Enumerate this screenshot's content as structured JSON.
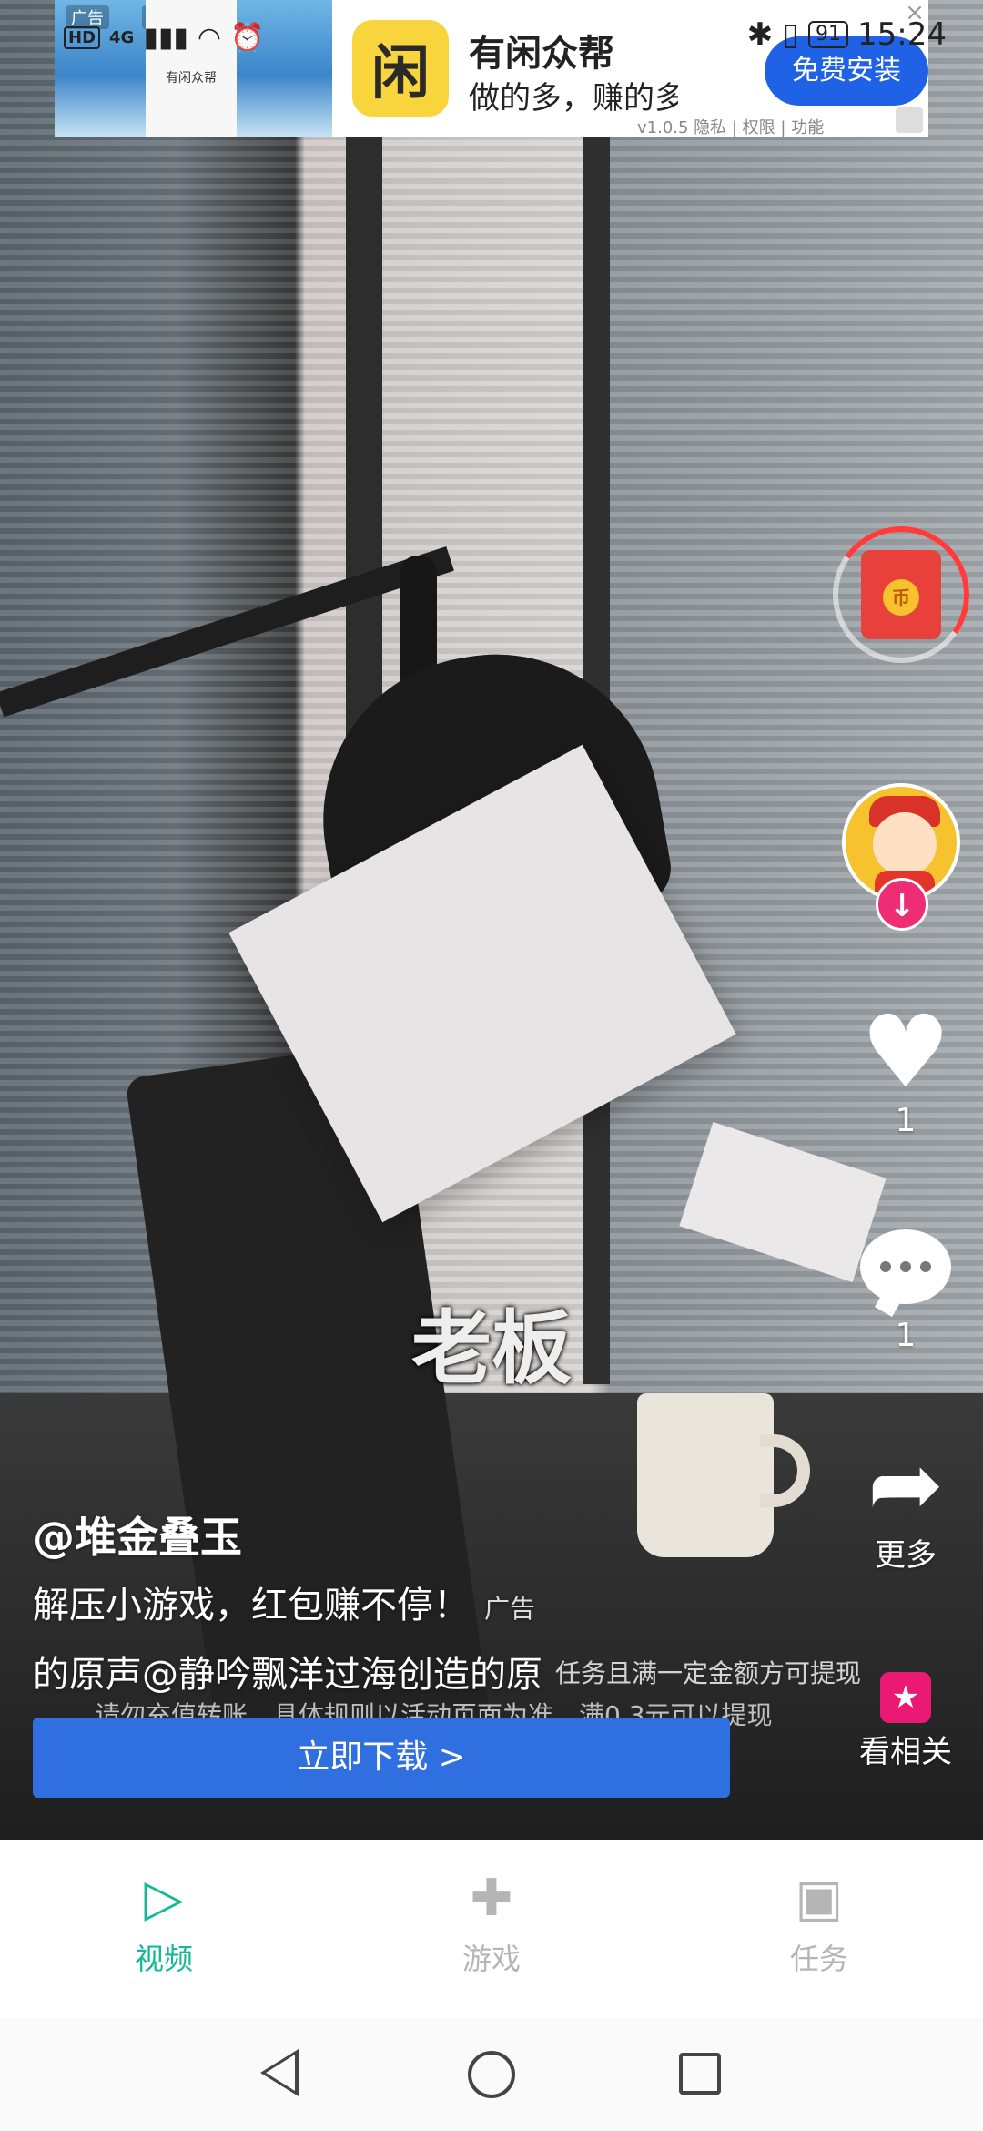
{
  "status_bar": {
    "network": "4G",
    "hd": "HD",
    "battery": "91",
    "time": "15:24"
  },
  "top_ad": {
    "tag_left": "广告",
    "tag_right": "广告",
    "thumb_app_name": "有闲众帮",
    "logo_char": "闲",
    "title": "有闲众帮",
    "subtitle": "做的多，赚的多!",
    "install_label": "免费安装",
    "meta": "v1.0.5 隐私 | 权限 | 功能",
    "close": "×"
  },
  "video": {
    "subtitle": "老板"
  },
  "sidebar": {
    "redpacket_icon": "coin-icon",
    "redpacket_coin": "币",
    "follow_symbol": "↓",
    "like_count": "1",
    "comment_count": "1",
    "share_label": "更多",
    "related_label": "看相关",
    "related_symbol": "★"
  },
  "post": {
    "username": "@堆金叠玉",
    "description": "解压小游戏，红包赚不停！",
    "ad_label": "广告",
    "music": "的原声@静吟飘洋过海创造的原",
    "music_overlay": "任务且满一定金额方可提现",
    "notice": "请勿充值转账，具体规则以活动页面为准，满0.3元可以提现",
    "download_label": "立即下载 >"
  },
  "bottom_nav": {
    "items": [
      {
        "label": "视频",
        "icon": "play-icon"
      },
      {
        "label": "游戏",
        "icon": "gamepad-icon"
      },
      {
        "label": "任务",
        "icon": "gift-icon"
      }
    ]
  }
}
